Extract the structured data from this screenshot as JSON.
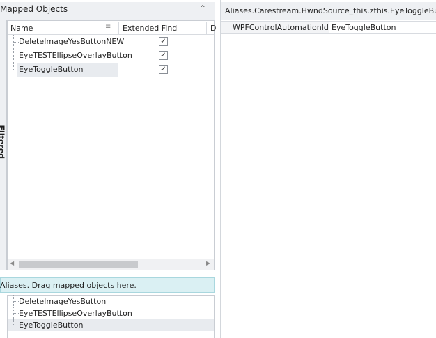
{
  "mapped_panel": {
    "title": "Mapped Objects",
    "filtered_label": "Filtered",
    "columns": {
      "name": "Name",
      "extended_find": "Extended Find",
      "next": "D"
    },
    "rows": [
      {
        "name": "DeleteImageYesButtonNEW",
        "extended_find": "✓"
      },
      {
        "name": "EyeTESTEllipseOverlayButton",
        "extended_find": "✓"
      },
      {
        "name": "EyeToggleButton",
        "extended_find": "✓"
      }
    ]
  },
  "aliases_panel": {
    "hint": "Aliases. Drag mapped objects here.",
    "items": [
      "DeleteImageYesButton",
      "EyeTESTEllipseOverlayButton",
      "EyeToggleButton"
    ]
  },
  "properties_panel": {
    "title": "Aliases.Carestream.HwndSource_this.zthis.EyeToggleButton",
    "properties": [
      {
        "name": "WPFControlAutomationId",
        "value": "EyeToggleButton"
      }
    ]
  },
  "icons": {
    "collapse": "double-chevron-up-icon",
    "sort": "sort-lines-icon",
    "checkbox_checked": "checkmark-icon",
    "scroll_left": "triangle-left-icon",
    "scroll_right": "triangle-right-icon"
  }
}
